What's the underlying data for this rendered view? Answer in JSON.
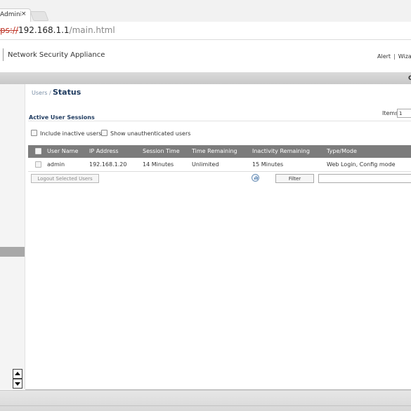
{
  "browser": {
    "tab_title": "Adminis",
    "tab_close": "×",
    "url_scheme": "ps://",
    "url_host": "192.168.1.1",
    "url_path": "/main.html"
  },
  "header": {
    "app_title": "Network Security Appliance",
    "links": [
      "Alert",
      "Wiza"
    ],
    "separator": "|",
    "band_edge_char": "C"
  },
  "page": {
    "breadcrumb_parent": "Users /",
    "title": "Status"
  },
  "sessions": {
    "section_title": "Active User Sessions",
    "items_label": "Items",
    "items_value": "1",
    "include_inactive_label": "Include inactive users",
    "show_unauthenticated_label": "Show unauthenticated users",
    "columns": [
      "User Name",
      "IP Address",
      "Session Time",
      "Time Remaining",
      "Inactivity Remaining",
      "Type/Mode"
    ],
    "rows": [
      [
        "admin",
        "192.168.1.20",
        "14 Minutes",
        "Unlimited",
        "15 Minutes",
        "Web Login, Config mode"
      ]
    ],
    "logout_button": "Logout Selected Users",
    "filter_button": "Filter",
    "filter_value": ""
  },
  "icons": {
    "stats": "bar-chart-icon",
    "scroll_up": "triangle-up-icon",
    "scroll_down": "triangle-down-icon"
  }
}
